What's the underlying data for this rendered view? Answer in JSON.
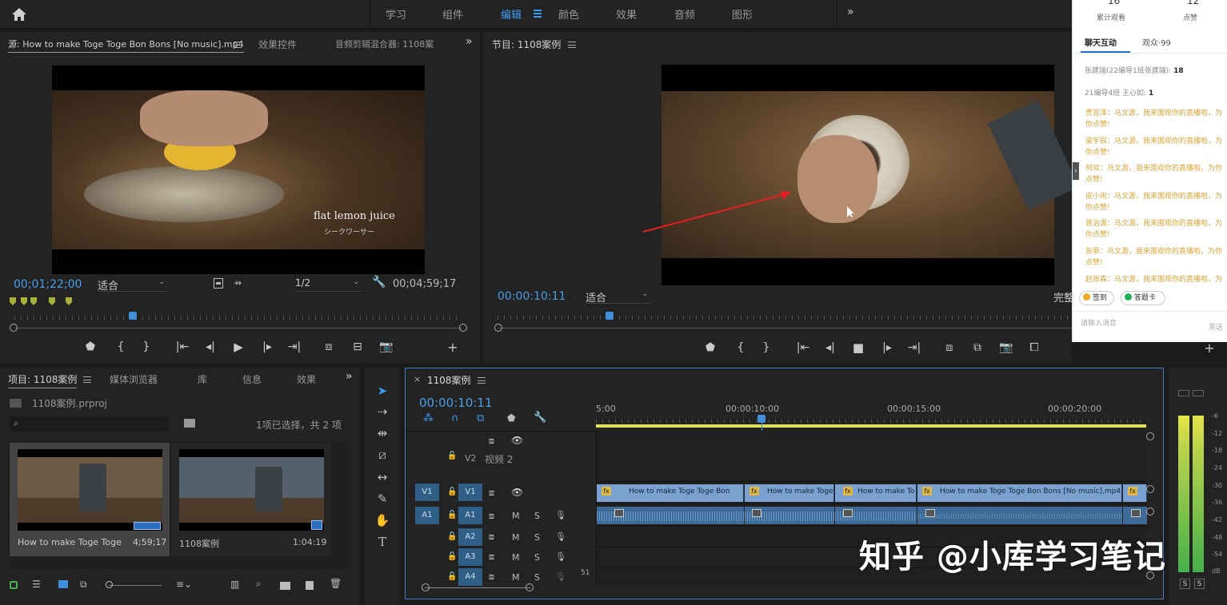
{
  "workspaces": [
    "学习",
    "组件",
    "编辑",
    "颜色",
    "效果",
    "音频",
    "图形"
  ],
  "workspace_active_index": 2,
  "source_panel": {
    "tab_title": "源: How to make Toge Toge Bon Bons [No music].mp4",
    "tab_effects": "效果控件",
    "tab_audio_mixer": "音频剪辑混合器: 1108案",
    "overlay_text": "flat lemon juice",
    "overlay_subtext": "シークワーサー",
    "timecode": "00;01;22;00",
    "fit": "适合",
    "resolution": "1/2",
    "duration": "00;04;59;17"
  },
  "program_panel": {
    "tab_title": "节目: 1108案例",
    "timecode": "00:00:10:11",
    "fit": "适合",
    "quality": "完整"
  },
  "live_panel": {
    "stat1_value": "16",
    "stat1_label": "累计观看",
    "stat2_value": "12",
    "stat2_label": "点赞",
    "tab_chat": "聊天互动",
    "tab_audience": "观众·99",
    "sys1_text": "张建瑞(22编导1班张建瑞):",
    "sys1_count": "18",
    "sys2_text": "21编导4班 王心如:",
    "sys2_count": "1",
    "messages": [
      {
        "name": "贾芸泽",
        "text": "马文源，我来围观你的直播啦，为",
        "cont": "你点赞!"
      },
      {
        "name": "梁宇辰",
        "text": "马文源，我来围观你的直播啦，为",
        "cont": "你点赞!"
      },
      {
        "name": "何欢",
        "text": "马文源，我来围观你的直播啦，为你",
        "cont": "点赞!"
      },
      {
        "name": "皮小雨",
        "text": "马文源，我来围观你的直播啦，为",
        "cont": "你点赞!"
      },
      {
        "name": "曾治源",
        "text": "马文源，我来围观你的直播啦，为",
        "cont": "你点赞!"
      },
      {
        "name": "张菲",
        "text": "马文源，我来围观你的直播啦，为你",
        "cont": "点赞!"
      },
      {
        "name": "赵雨森",
        "text": "马文源，我来围观你的直播啦，为",
        "cont": ""
      }
    ],
    "btn_checkin": "签到",
    "btn_answer": "答题卡",
    "input_placeholder": "请输入消息",
    "send": "发送"
  },
  "project_panel": {
    "tab_project": "项目: 1108案例",
    "tab_media": "媒体浏览器",
    "tab_library": "库",
    "tab_info": "信息",
    "tab_effects": "效果",
    "file_name": "1108案例.prproj",
    "selection_info": "1项已选择，共 2 项",
    "items": [
      {
        "name": "How to make Toge Toge ...",
        "duration": "4;59;17"
      },
      {
        "name": "1108案例",
        "duration": "1:04:19"
      }
    ]
  },
  "timeline": {
    "tab_title": "1108案例",
    "timecode": "00:00:10:11",
    "ruler_labels": [
      "5:00",
      "00:00:10:00",
      "00:00:15:00",
      "00:00:20:00"
    ],
    "v2_name": "视频 2",
    "tracks": [
      "V2",
      "V1",
      "A1",
      "A2",
      "A3",
      "A4"
    ],
    "clips": [
      {
        "label": "How to make Toge Toge Bon Bon"
      },
      {
        "label": "How to make Toge"
      },
      {
        "label": "How to make To"
      },
      {
        "label": "How to make Toge Toge Bon Bons [No music].mp4 [V]"
      },
      {
        "label": ""
      }
    ],
    "a4_value": "51",
    "mute_label": "M",
    "solo_label": "S"
  },
  "audio_meter": {
    "scale": [
      "-6",
      "-12",
      "-18",
      "-24",
      "-30",
      "-36",
      "-42",
      "-48",
      "-54",
      "dB"
    ],
    "solo_left": "S",
    "solo_right": "S"
  },
  "watermark": "知乎 @小库学习笔记"
}
